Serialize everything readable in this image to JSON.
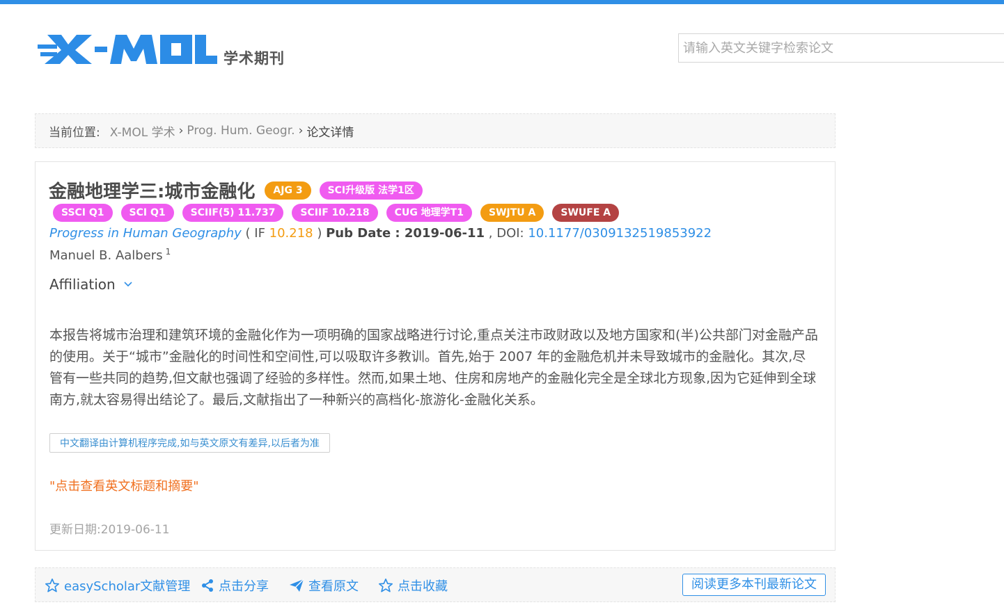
{
  "header": {
    "logo_sub": "学术期刊",
    "search_placeholder": "请输入英文关键字检索论文"
  },
  "breadcrumb": {
    "current_label": "当前位置:",
    "items": [
      "X-MOL 学术",
      "Prog. Hum. Geogr.",
      "论文详情"
    ],
    "separator": "›"
  },
  "article": {
    "title": "金融地理学三:城市金融化",
    "title_badges": [
      {
        "text": "AJG 3",
        "color": "#f39c12"
      },
      {
        "text": "SCI升级版 法学1区",
        "color": "#f05bf0"
      }
    ],
    "badges": [
      {
        "text": "SSCI Q1",
        "color": "#f05bf0"
      },
      {
        "text": "SCI Q1",
        "color": "#f05bf0"
      },
      {
        "text": "SCIIF(5) 11.737",
        "color": "#f05bf0"
      },
      {
        "text": "SCIIF 10.218",
        "color": "#f05bf0"
      },
      {
        "text": "CUG 地理学T1",
        "color": "#f05bf0"
      },
      {
        "text": "SWJTU A",
        "color": "#f39c12"
      },
      {
        "text": "SWUFE A",
        "color": "#b44343"
      }
    ],
    "journal": "Progress in Human Geography",
    "if_prefix": " ( IF ",
    "if_value": "10.218",
    "if_suffix": " ) ",
    "pub_label": "Pub Date : 2019-06-11",
    "doi_label": " , DOI: ",
    "doi": "10.1177/0309132519853922",
    "author": "Manuel B. Aalbers",
    "author_sup": "1",
    "affiliation_label": "Affiliation",
    "abstract": "本报告将城市治理和建筑环境的金融化作为一项明确的国家战略进行讨论,重点关注市政财政以及地方国家和(半)公共部门对金融产品的使用。关于“城市”金融化的时间性和空间性,可以吸取许多教训。首先,始于 2007 年的金融危机并未导致城市的金融化。其次,尽管有一些共同的趋势,但文献也强调了经验的多样性。然而,如果土地、住房和房地产的金融化完全是全球北方现象,因为它延伸到全球南方,就太容易得出结论了。最后,文献指出了一种新兴的高档化-旅游化-金融化关系。",
    "translation_note": "中文翻译由计算机程序完成,如与英文原文有差异,以后者为准",
    "english_link": "\"点击查看英文标题和摘要\"",
    "updated": "更新日期:2019-06-11"
  },
  "toolbar": {
    "easyscholar": "easyScholar文献管理",
    "share": "点击分享",
    "view_original": "查看原文",
    "favorite": "点击收藏",
    "more_button": "阅读更多本刊最新论文"
  }
}
